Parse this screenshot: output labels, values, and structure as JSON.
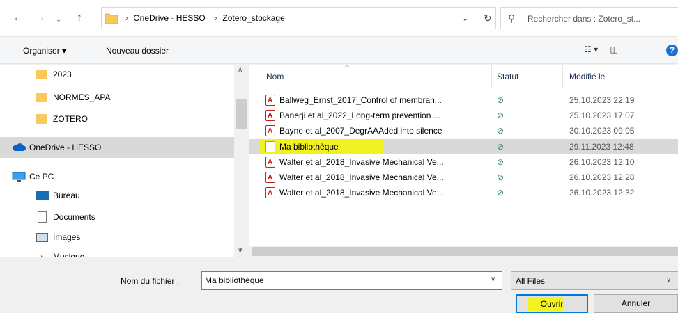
{
  "address": {
    "crumbs": [
      "OneDrive - HESSO",
      "Zotero_stockage"
    ]
  },
  "search": {
    "placeholder": "Rechercher dans : Zotero_st..."
  },
  "toolbar": {
    "organize": "Organiser ▾",
    "new_folder": "Nouveau dossier"
  },
  "nav": {
    "items": [
      {
        "label": "2023"
      },
      {
        "label": "NORMES_APA"
      },
      {
        "label": "ZOTERO"
      },
      {
        "label": "OneDrive - HESSO"
      },
      {
        "label": "Ce PC"
      },
      {
        "label": "Bureau"
      },
      {
        "label": "Documents"
      },
      {
        "label": "Images"
      },
      {
        "label": "Musique"
      }
    ]
  },
  "columns": {
    "name": "Nom",
    "status": "Statut",
    "modified": "Modifié le"
  },
  "files": [
    {
      "name": "Ballweg_Ernst_2017_Control of membran...",
      "modified": "25.10.2023 22:19"
    },
    {
      "name": "Banerji et al_2022_Long-term prevention ...",
      "modified": "25.10.2023 17:07"
    },
    {
      "name": "Bayne et al_2007_DegrAAAded into silence",
      "modified": "30.10.2023 09:05"
    },
    {
      "name": "Ma bibliothèque",
      "modified": "29.11.2023 12:48"
    },
    {
      "name": "Walter et al_2018_Invasive Mechanical Ve...",
      "modified": "26.10.2023 12:10"
    },
    {
      "name": "Walter et al_2018_Invasive Mechanical Ve...",
      "modified": "26.10.2023 12:28"
    },
    {
      "name": "Walter et al_2018_Invasive Mechanical Ve...",
      "modified": "26.10.2023 12:32"
    }
  ],
  "status_icon": "sync-check-icon",
  "bottom": {
    "filename_label": "Nom du fichier :",
    "filename_value": "Ma bibliothèque",
    "filter": "All Files",
    "open": "Ouvrir",
    "cancel": "Annuler"
  },
  "colors": {
    "highlight": "#f6f400",
    "accent": "#0078d7",
    "folder": "#f8c95c"
  }
}
